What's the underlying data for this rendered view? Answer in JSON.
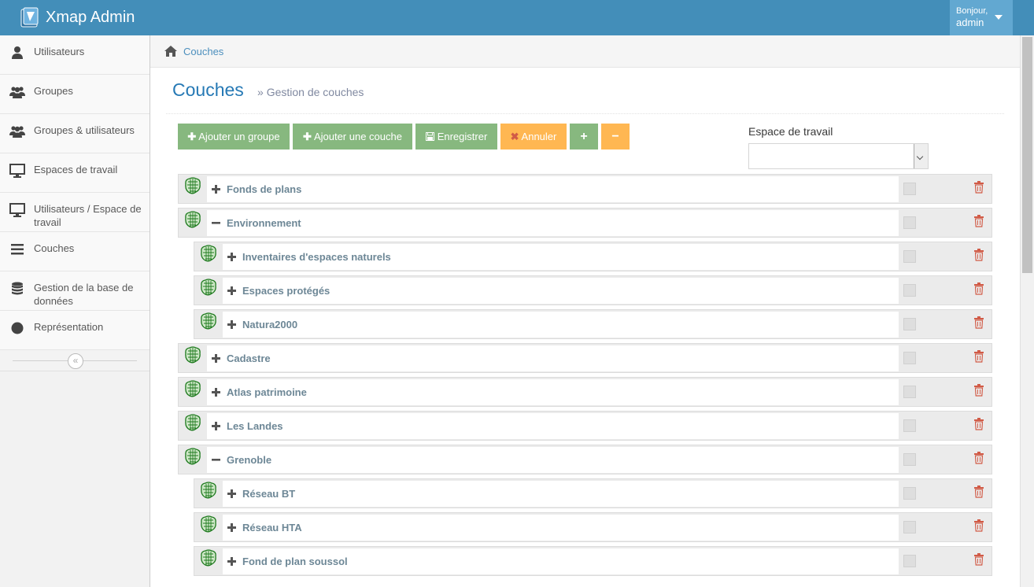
{
  "app": {
    "title": "Xmap Admin"
  },
  "user": {
    "greeting": "Bonjour,",
    "name": "admin"
  },
  "sidebar": {
    "items": [
      {
        "label": "Utilisateurs",
        "icon": "user-icon"
      },
      {
        "label": "Groupes",
        "icon": "users-icon"
      },
      {
        "label": "Groupes & utilisateurs",
        "icon": "users-icon"
      },
      {
        "label": "Espaces de travail",
        "icon": "desktop-icon"
      },
      {
        "label": "Utilisateurs / Espace de travail",
        "icon": "desktop-icon"
      },
      {
        "label": "Couches",
        "icon": "bars-icon"
      },
      {
        "label": "Gestion de la base de données",
        "icon": "database-icon"
      },
      {
        "label": "Représentation",
        "icon": "circle-icon"
      }
    ],
    "collapse_glyph": "«"
  },
  "breadcrumb": {
    "current": "Couches"
  },
  "page": {
    "title": "Couches",
    "subtitle": "Gestion de couches",
    "subtitle_prefix": "»"
  },
  "toolbar": {
    "add_group": "Ajouter un groupe",
    "add_layer": "Ajouter une couche",
    "save": "Enregistrer",
    "cancel": "Annuler",
    "plus": "+",
    "minus": "−"
  },
  "workspace": {
    "label": "Espace de travail",
    "selected": ""
  },
  "colors": {
    "navbar": "#438eb9",
    "green": "#87b87f",
    "orange": "#ffb752",
    "link": "#2679b5",
    "delete": "#d15b47"
  },
  "tree": [
    {
      "label": "Fonds de plans",
      "level": 0,
      "expanded": false
    },
    {
      "label": "Environnement",
      "level": 0,
      "expanded": true
    },
    {
      "label": "Inventaires d'espaces naturels",
      "level": 1,
      "expanded": false
    },
    {
      "label": "Espaces protégés",
      "level": 1,
      "expanded": false
    },
    {
      "label": "Natura2000",
      "level": 1,
      "expanded": false
    },
    {
      "label": "Cadastre",
      "level": 0,
      "expanded": false
    },
    {
      "label": "Atlas patrimoine",
      "level": 0,
      "expanded": false
    },
    {
      "label": "Les Landes",
      "level": 0,
      "expanded": false
    },
    {
      "label": "Grenoble",
      "level": 0,
      "expanded": true
    },
    {
      "label": "Réseau BT",
      "level": 1,
      "expanded": false
    },
    {
      "label": "Réseau HTA",
      "level": 1,
      "expanded": false
    },
    {
      "label": "Fond de plan soussol",
      "level": 1,
      "expanded": false
    }
  ]
}
